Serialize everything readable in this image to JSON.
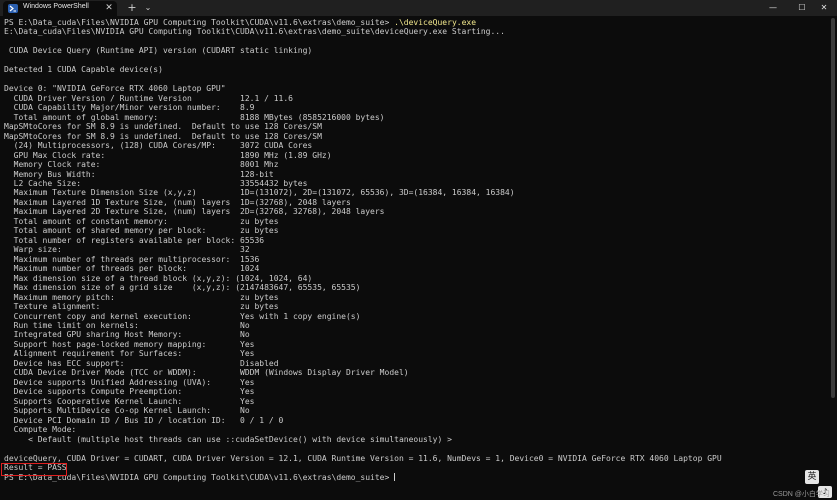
{
  "window": {
    "tab_title": "Windows PowerShell",
    "tab_close_glyph": "✕",
    "new_tab_glyph": "+",
    "tab_menu_glyph": "⌄",
    "minimize_glyph": "—",
    "maximize_glyph": "☐",
    "close_glyph": "✕"
  },
  "terminal": {
    "prompt1": "PS E:\\Data_cuda\\Files\\NVIDIA GPU Computing Toolkit\\CUDA\\v11.6\\extras\\demo_suite> ",
    "command": ".\\deviceQuery.exe",
    "line_1": "E:\\Data_cuda\\Files\\NVIDIA GPU Computing Toolkit\\CUDA\\v11.6\\extras\\demo_suite\\deviceQuery.exe Starting...",
    "line_2": "",
    "line_3": " CUDA Device Query (Runtime API) version (CUDART static linking)",
    "line_4": "",
    "line_5": "Detected 1 CUDA Capable device(s)",
    "line_6": "",
    "line_7": "Device 0: \"NVIDIA GeForce RTX 4060 Laptop GPU\"",
    "line_8": "  CUDA Driver Version / Runtime Version          12.1 / 11.6",
    "line_9": "  CUDA Capability Major/Minor version number:    8.9",
    "line_10": "  Total amount of global memory:                 8188 MBytes (8585216000 bytes)",
    "line_11": "MapSMtoCores for SM 8.9 is undefined.  Default to use 128 Cores/SM",
    "line_12": "MapSMtoCores for SM 8.9 is undefined.  Default to use 128 Cores/SM",
    "line_13": "  (24) Multiprocessors, (128) CUDA Cores/MP:     3072 CUDA Cores",
    "line_14": "  GPU Max Clock rate:                            1890 MHz (1.89 GHz)",
    "line_15": "  Memory Clock rate:                             8001 Mhz",
    "line_16": "  Memory Bus Width:                              128-bit",
    "line_17": "  L2 Cache Size:                                 33554432 bytes",
    "line_18": "  Maximum Texture Dimension Size (x,y,z)         1D=(131072), 2D=(131072, 65536), 3D=(16384, 16384, 16384)",
    "line_19": "  Maximum Layered 1D Texture Size, (num) layers  1D=(32768), 2048 layers",
    "line_20": "  Maximum Layered 2D Texture Size, (num) layers  2D=(32768, 32768), 2048 layers",
    "line_21": "  Total amount of constant memory:               zu bytes",
    "line_22": "  Total amount of shared memory per block:       zu bytes",
    "line_23": "  Total number of registers available per block: 65536",
    "line_24": "  Warp size:                                     32",
    "line_25": "  Maximum number of threads per multiprocessor:  1536",
    "line_26": "  Maximum number of threads per block:           1024",
    "line_27": "  Max dimension size of a thread block (x,y,z): (1024, 1024, 64)",
    "line_28": "  Max dimension size of a grid size    (x,y,z): (2147483647, 65535, 65535)",
    "line_29": "  Maximum memory pitch:                          zu bytes",
    "line_30": "  Texture alignment:                             zu bytes",
    "line_31": "  Concurrent copy and kernel execution:          Yes with 1 copy engine(s)",
    "line_32": "  Run time limit on kernels:                     No",
    "line_33": "  Integrated GPU sharing Host Memory:            No",
    "line_34": "  Support host page-locked memory mapping:       Yes",
    "line_35": "  Alignment requirement for Surfaces:            Yes",
    "line_36": "  Device has ECC support:                        Disabled",
    "line_37": "  CUDA Device Driver Mode (TCC or WDDM):         WDDM (Windows Display Driver Model)",
    "line_38": "  Device supports Unified Addressing (UVA):      Yes",
    "line_39": "  Device supports Compute Preemption:            Yes",
    "line_40": "  Supports Cooperative Kernel Launch:            Yes",
    "line_41": "  Supports MultiDevice Co-op Kernel Launch:      No",
    "line_42": "  Device PCI Domain ID / Bus ID / location ID:   0 / 1 / 0",
    "line_43": "  Compute Mode:",
    "line_44": "     < Default (multiple host threads can use ::cudaSetDevice() with device simultaneously) >",
    "line_45": "",
    "line_46": "deviceQuery, CUDA Driver = CUDART, CUDA Driver Version = 12.1, CUDA Runtime Version = 11.6, NumDevs = 1, Device0 = NVIDIA GeForce RTX 4060 Laptop GPU",
    "result": "Result = PASS",
    "prompt2": "PS E:\\Data_cuda\\Files\\NVIDIA GPU Computing Toolkit\\CUDA\\v11.6\\extras\\demo_suite> "
  },
  "watermark": "CSDN @小白学习",
  "badges": {
    "badge1": "英",
    "badge2": "♪"
  },
  "colors": {
    "background": "#0c0c0c",
    "text": "#cccccc",
    "command": "#f0e68c",
    "result_highlight": "#e02020"
  }
}
